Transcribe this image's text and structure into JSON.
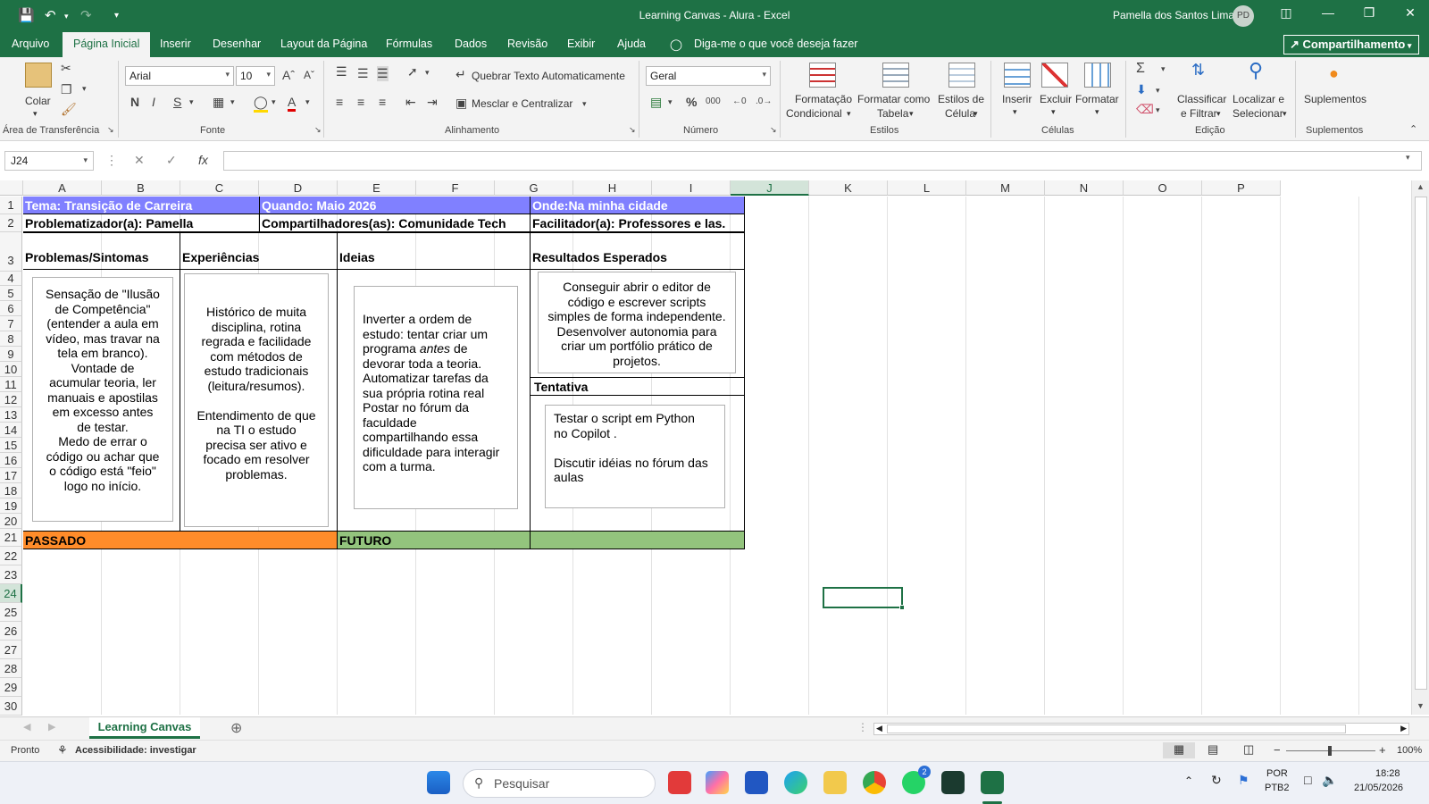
{
  "window": {
    "title": "Learning Canvas - Alura  -  Excel",
    "user": "Pamella dos Santos Lima",
    "avatar": "PD"
  },
  "menu": {
    "tabs": [
      "Arquivo",
      "Página Inicial",
      "Inserir",
      "Desenhar",
      "Layout da Página",
      "Fórmulas",
      "Dados",
      "Revisão",
      "Exibir",
      "Ajuda"
    ],
    "active": "Página Inicial",
    "tell_me": "Diga-me o que você deseja fazer",
    "share": "Compartilhamento"
  },
  "ribbon": {
    "paste": "Colar",
    "clipboard_group": "Área de Transferência",
    "font_name": "Arial",
    "font_size": "10",
    "font_group": "Fonte",
    "wrap_text": "Quebrar Texto Automaticamente",
    "merge_center": "Mesclar e Centralizar",
    "alignment_group": "Alinhamento",
    "number_format": "Geral",
    "number_group": "Número",
    "cond_format_1": "Formatação",
    "cond_format_2": "Condicional",
    "format_table_1": "Formatar como",
    "format_table_2": "Tabela",
    "cell_styles_1": "Estilos de",
    "cell_styles_2": "Célula",
    "styles_group": "Estilos",
    "insert": "Inserir",
    "delete": "Excluir",
    "format": "Formatar",
    "cells_group": "Células",
    "sort_1": "Classificar",
    "sort_2": "e Filtrar",
    "find_1": "Localizar e",
    "find_2": "Selecionar",
    "editing_group": "Edição",
    "addins": "Suplementos",
    "addins_group": "Suplementos"
  },
  "formula_bar": {
    "name_box": "J24",
    "formula": ""
  },
  "grid": {
    "columns": [
      "A",
      "B",
      "C",
      "D",
      "E",
      "F",
      "G",
      "H",
      "I",
      "J",
      "K",
      "L",
      "M",
      "N",
      "O",
      "P"
    ],
    "selected_column": "J",
    "rows": [
      "1",
      "2",
      "3",
      "4",
      "5",
      "6",
      "7",
      "8",
      "9",
      "10",
      "11",
      "12",
      "13",
      "14",
      "15",
      "16",
      "17",
      "18",
      "19",
      "20",
      "21",
      "22",
      "23",
      "24",
      "25",
      "26",
      "27",
      "28",
      "29",
      "30"
    ],
    "selected_row": "24"
  },
  "canvas": {
    "tema": "Tema: Transição de Carreira",
    "quando": "Quando: Maio 2026",
    "onde": "Onde:Na minha cidade",
    "problematizador": "Problematizador(a): Pamella",
    "compartilhadores": "Compartilhadores(as): Comunidade Tech",
    "facilitador": "Facilitador(a): Professores e las.",
    "h_problemas": "Problemas/Sintomas",
    "h_experiencias": "Experiências",
    "h_ideias": "Ideias",
    "h_resultados": "Resultados Esperados",
    "h_tentativa": "Tentativa",
    "passado": "PASSADO",
    "futuro": "FUTURO",
    "problemas_lines": [
      "Sensação de \"Ilusão",
      "de Competência\"",
      "(entender a aula em",
      "vídeo, mas travar na",
      "tela em branco).",
      "Vontade de",
      "acumular teoria, ler",
      "manuais e apostilas",
      "em excesso antes",
      "de testar.",
      "Medo de errar o",
      "código ou achar que",
      "o código está \"feio\"",
      "logo no início."
    ],
    "experiencias_lines": [
      "Histórico de muita",
      "disciplina, rotina",
      "regrada e facilidade",
      "com métodos de",
      "estudo tradicionais",
      "(leitura/resumos).",
      "",
      "Entendimento de que",
      "na TI o estudo",
      "precisa ser ativo e",
      "focado em resolver",
      "problemas."
    ],
    "ideias_line1": "Inverter a ordem de",
    "ideias_line2": "estudo: tentar criar um",
    "ideias_line3_a": "programa ",
    "ideias_line3_em": "antes",
    "ideias_line3_b": " de",
    "ideias_rest": [
      "devorar toda a teoria.",
      "Automatizar tarefas da",
      "sua própria rotina real",
      "Postar no fórum da",
      "faculdade",
      "compartilhando essa",
      "dificuldade para interagir",
      "com a turma."
    ],
    "resultados_lines": [
      "Conseguir abrir o editor de",
      "código e escrever scripts",
      "simples de forma independente.",
      "Desenvolver autonomia para",
      "criar um portfólio prático de",
      "projetos."
    ],
    "tentativa_lines": [
      "Testar o script em Python",
      "no Copilot .",
      "",
      "Discutir idéias no fórum das",
      "aulas"
    ]
  },
  "sheets": {
    "active": "Learning Canvas"
  },
  "status": {
    "ready": "Pronto",
    "accessibility": "Acessibilidade: investigar",
    "zoom": "100%"
  },
  "taskbar": {
    "search": "Pesquisar",
    "lang1": "POR",
    "lang2": "PTB2",
    "time": "18:28",
    "date": "21/05/2026",
    "whatsapp_badge": "2"
  }
}
